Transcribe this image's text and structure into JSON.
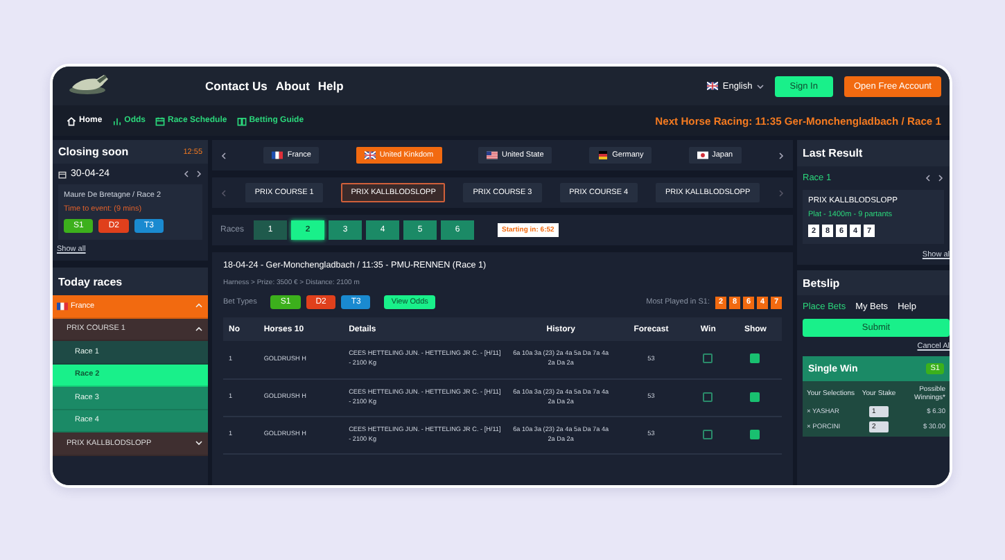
{
  "nav": {
    "links": [
      "Contact Us",
      "About",
      "Help"
    ],
    "language": "English",
    "sign_in": "Sign In",
    "open_account": "Open Free Account"
  },
  "subnav": {
    "items": [
      {
        "label": "Home",
        "kind": "home",
        "selected": true
      },
      {
        "label": "Odds",
        "kind": "odds",
        "selected": false
      },
      {
        "label": "Race Schedule",
        "kind": "schedule",
        "selected": false
      },
      {
        "label": "Betting Guide",
        "kind": "guide",
        "selected": false
      }
    ],
    "next_racing": "Next Horse Racing: 11:35 Ger-Monchengladbach / Race 1"
  },
  "closing_soon": {
    "title": "Closing soon",
    "time": "12:55",
    "date": "30-04-24",
    "race": "Maure De Bretagne / Race 2",
    "time_to_event": "Time to event: (9 mins)",
    "bet_types": [
      {
        "label": "S1",
        "color": "#3cb01c"
      },
      {
        "label": "D2",
        "color": "#e0401c"
      },
      {
        "label": "T3",
        "color": "#1a8ad0"
      }
    ],
    "show_all": "Show all"
  },
  "today_races": {
    "title": "Today races",
    "items": [
      {
        "label": "France",
        "kind": "fr",
        "expanded": true,
        "children": [
          {
            "label": "PRIX COURSE 1",
            "expanded": true,
            "children": [
              {
                "label": "Race 1",
                "selected": false,
                "finished": true
              },
              {
                "label": "Race 2",
                "selected": true,
                "finished": false
              },
              {
                "label": "Race 3",
                "selected": false,
                "finished": false
              },
              {
                "label": "Race 4",
                "selected": false,
                "finished": false
              }
            ]
          },
          {
            "label": "PRIX KALLBLODSLOPP",
            "expanded": false
          }
        ]
      }
    ]
  },
  "countries": [
    {
      "label": "France",
      "kind": "fr",
      "selected": false
    },
    {
      "label": "United Kinkdom",
      "kind": "uk",
      "selected": true
    },
    {
      "label": "United State",
      "kind": "us",
      "selected": false
    },
    {
      "label": "Germany",
      "kind": "de",
      "selected": false
    },
    {
      "label": "Japan",
      "kind": "jp",
      "selected": false
    }
  ],
  "courses": [
    {
      "label": "PRIX COURSE 1",
      "selected": false
    },
    {
      "label": "PRIX KALLBLODSLOPP",
      "selected": true
    },
    {
      "label": "PRIX COURSE 3",
      "selected": false
    },
    {
      "label": "PRIX COURSE 4",
      "selected": false
    },
    {
      "label": "PRIX KALLBLODSLOPP",
      "selected": false
    }
  ],
  "races": {
    "label": "Races",
    "items": [
      {
        "label": "1",
        "selected": false,
        "finished": true
      },
      {
        "label": "2",
        "selected": true,
        "finished": false
      },
      {
        "label": "3",
        "selected": false,
        "finished": false
      },
      {
        "label": "4",
        "selected": false,
        "finished": false
      },
      {
        "label": "5",
        "selected": false,
        "finished": false
      },
      {
        "label": "6",
        "selected": false,
        "finished": false
      }
    ],
    "starting": "Starting in: 6:52"
  },
  "race_info": {
    "title": "18-04-24 - Ger-Monchengladbach / 11:35 - PMU-RENNEN (Race 1)",
    "subtitle": "Harness > Prize: 3500 € > Distance: 2100 m",
    "bet_types_label": "Bet Types",
    "bet_types": [
      {
        "label": "S1",
        "color": "#3cb01c"
      },
      {
        "label": "D2",
        "color": "#e0401c"
      },
      {
        "label": "T3",
        "color": "#1a8ad0"
      }
    ],
    "view_odds": "View Odds",
    "most_played_label": "Most Played in S1:",
    "most_played": [
      "2",
      "8",
      "6",
      "4",
      "7"
    ]
  },
  "table": {
    "columns": [
      "No",
      "Horses 10",
      "Details",
      "History",
      "Forecast",
      "Win",
      "Show"
    ],
    "rows": [
      {
        "no": "1",
        "horse": "GOLDRUSH H",
        "details": "CEES HETTELING JUN. - HETTELING JR C. - [H/11] - 2100 Kg",
        "history": "6a 10a 3a (23) 2a 4a 5a Da 7a 4a 2a Da 2a",
        "forecast": "53",
        "win": false,
        "show": true
      },
      {
        "no": "1",
        "horse": "GOLDRUSH H",
        "details": "CEES HETTELING JUN. - HETTELING JR C. - [H/11] - 2100 Kg",
        "history": "6a 10a 3a (23) 2a 4a 5a Da 7a 4a 2a Da 2a",
        "forecast": "53",
        "win": false,
        "show": true
      },
      {
        "no": "1",
        "horse": "GOLDRUSH H",
        "details": "CEES HETTELING JUN. - HETTELING JR C. - [H/11] - 2100 Kg",
        "history": "6a 10a 3a (23) 2a 4a 5a Da 7a 4a 2a Da 2a",
        "forecast": "53",
        "win": false,
        "show": true
      }
    ]
  },
  "last_result": {
    "title": "Last Result",
    "race": "Race 1",
    "name": "PRIX KALLBLODSLOPP",
    "details": "Plat - 1400m - 9 partants",
    "numbers": [
      "2",
      "8",
      "6",
      "4",
      "7"
    ],
    "show_all": "Show al"
  },
  "betslip": {
    "title": "Betslip",
    "tabs": [
      {
        "label": "Place Bets",
        "selected": true
      },
      {
        "label": "My Bets",
        "selected": false
      },
      {
        "label": "Help",
        "selected": false
      }
    ],
    "submit": "Submit",
    "cancel": "Cancel Al",
    "single": {
      "title": "Single Win",
      "badge": "S1",
      "columns": [
        "Your Selections",
        "Your Stake",
        "Possible Winnings*"
      ],
      "selections": [
        {
          "name": "× YASHAR",
          "stake": "1",
          "winnings": "$ 6.30"
        },
        {
          "name": "× PORCINI",
          "stake": "2",
          "winnings": "$ 30.00"
        }
      ]
    }
  }
}
